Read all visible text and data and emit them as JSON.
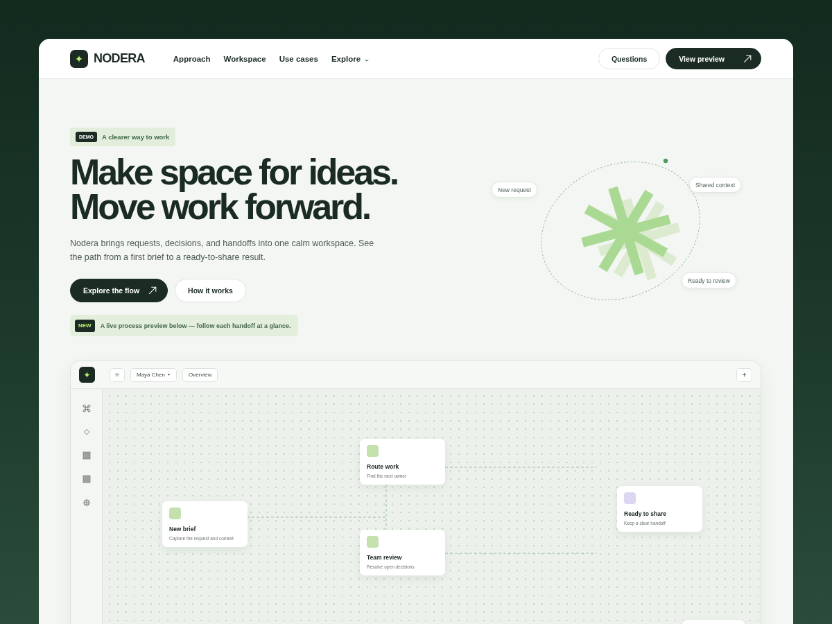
{
  "header": {
    "brand": "NODERA",
    "nav": [
      {
        "label": "Approach",
        "kind": "link"
      },
      {
        "label": "Workspace",
        "kind": "link"
      },
      {
        "label": "Use cases",
        "kind": "link"
      },
      {
        "label": "Explore",
        "kind": "menu"
      }
    ],
    "actions": [
      {
        "label": "Questions",
        "kind": "secondary"
      },
      {
        "label": "View preview",
        "kind": "primary"
      }
    ]
  },
  "hero": {
    "badge": {
      "tag": "DEMO",
      "text": "A clearer way to work"
    },
    "headline": [
      "Make space for ideas.",
      "Move work forward."
    ],
    "description": "Nodera brings requests, decisions, and handoffs into one calm workspace. See the path from a first brief to a ready-to-share result.",
    "buttons": [
      {
        "label": "Explore the flow",
        "kind": "primary"
      },
      {
        "label": "How it works",
        "kind": "secondary"
      }
    ],
    "notice": {
      "tag": "NEW",
      "text": "A live process preview below — follow each handoff at a glance."
    }
  },
  "illustration": {
    "labels": [
      "New request",
      "Shared context",
      "Ready to review"
    ]
  },
  "preview": {
    "toolbar": {
      "user": "Maya Chen",
      "view": "Overview"
    },
    "canvas": {
      "nodes": [
        {
          "title": "New brief",
          "subtitle": "Capture the request and context",
          "color": "#c3e0ad"
        },
        {
          "title": "Route work",
          "subtitle": "Find the next owner",
          "color": "#c3e0ad"
        },
        {
          "title": "Team review",
          "subtitle": "Resolve open decisions",
          "color": "#c3e0ad"
        },
        {
          "title": "Ready to share",
          "subtitle": "Keep a clear handoff",
          "color": "#dcd6f0"
        }
      ]
    }
  }
}
